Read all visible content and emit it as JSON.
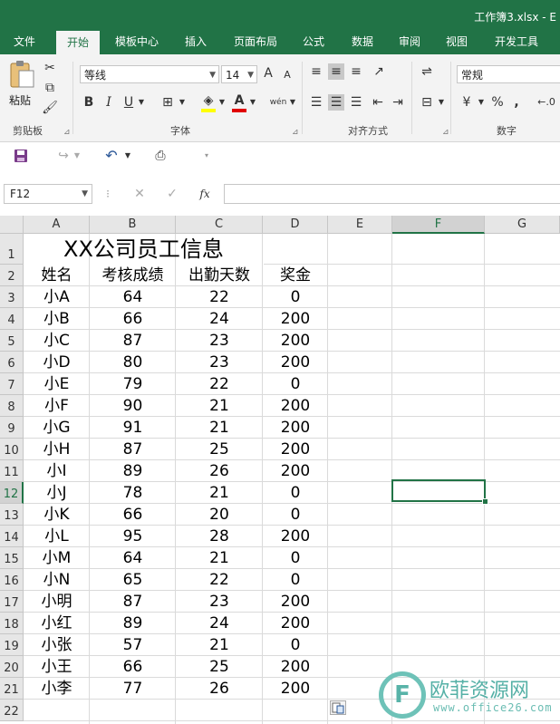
{
  "window": {
    "title": "工作簿3.xlsx - E"
  },
  "ribbon_tabs": [
    "文件",
    "开始",
    "模板中心",
    "插入",
    "页面布局",
    "公式",
    "数据",
    "审阅",
    "视图",
    "开发工具"
  ],
  "active_tab": "开始",
  "clipboard": {
    "paste_label": "粘贴",
    "group_label": "剪贴板"
  },
  "font": {
    "name": "等线",
    "size": "14",
    "group_label": "字体",
    "grow": "A",
    "shrink": "A",
    "bold": "B",
    "italic": "I",
    "underline": "U",
    "font_color_glyph": "A",
    "phonetic": "wén"
  },
  "alignment": {
    "group_label": "对齐方式"
  },
  "number": {
    "format": "常规",
    "group_label": "数字",
    "percent": "%",
    "comma": ","
  },
  "formula_bar": {
    "name_box": "F12",
    "fx": "fx",
    "value": ""
  },
  "columns": [
    "A",
    "B",
    "C",
    "D",
    "E",
    "F",
    "G"
  ],
  "selected_column": "F",
  "rows": [
    "1",
    "2",
    "3",
    "4",
    "5",
    "6",
    "7",
    "8",
    "9",
    "10",
    "11",
    "12",
    "13",
    "14",
    "15",
    "16",
    "17",
    "18",
    "19",
    "20",
    "21",
    "22"
  ],
  "selected_row": "12",
  "sheet": {
    "title": "XX公司员工信息",
    "headers": [
      "姓名",
      "考核成绩",
      "出勤天数",
      "奖金"
    ],
    "records": [
      [
        "小A",
        "64",
        "22",
        "0"
      ],
      [
        "小B",
        "66",
        "24",
        "200"
      ],
      [
        "小C",
        "87",
        "23",
        "200"
      ],
      [
        "小D",
        "80",
        "23",
        "200"
      ],
      [
        "小E",
        "79",
        "22",
        "0"
      ],
      [
        "小F",
        "90",
        "21",
        "200"
      ],
      [
        "小G",
        "91",
        "21",
        "200"
      ],
      [
        "小H",
        "87",
        "25",
        "200"
      ],
      [
        "小I",
        "89",
        "26",
        "200"
      ],
      [
        "小J",
        "78",
        "21",
        "0"
      ],
      [
        "小K",
        "66",
        "20",
        "0"
      ],
      [
        "小L",
        "95",
        "28",
        "200"
      ],
      [
        "小M",
        "64",
        "21",
        "0"
      ],
      [
        "小N",
        "65",
        "22",
        "0"
      ],
      [
        "小明",
        "87",
        "23",
        "200"
      ],
      [
        "小红",
        "89",
        "24",
        "200"
      ],
      [
        "小张",
        "57",
        "21",
        "0"
      ],
      [
        "小王",
        "66",
        "25",
        "200"
      ],
      [
        "小李",
        "77",
        "26",
        "200"
      ]
    ]
  },
  "watermark": {
    "logo": "F",
    "text": "欧菲资源网",
    "url": "www.office26.com"
  },
  "colors": {
    "accent": "#217346",
    "grid": "#dadada",
    "header_bg": "#e6e6e6"
  }
}
